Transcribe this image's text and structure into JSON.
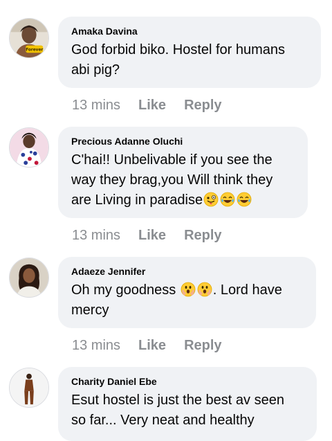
{
  "comments": [
    {
      "author": "Amaka Davina",
      "text_lines": [
        "God forbid biko. Hostel for humans",
        "abi pig?"
      ],
      "time": "13 mins",
      "like_label": "Like",
      "reply_label": "Reply"
    },
    {
      "author": "Precious Adanne Oluchi",
      "text_lines": [
        "C'hai!! Unbelivable if you see the",
        "way they  brag,you Will  think they",
        "are Living in paradise"
      ],
      "emojis": [
        "zany-face-emoji",
        "tears-of-joy-emoji",
        "tears-of-joy-emoji"
      ],
      "time": "13 mins",
      "like_label": "Like",
      "reply_label": "Reply"
    },
    {
      "author": "Adaeze Jennifer",
      "text_parts": [
        "Oh my goodness ",
        ". Lord have"
      ],
      "text_line2": "mercy",
      "emojis": [
        "shocked-face-emoji",
        "shocked-face-emoji"
      ],
      "time": "13 mins",
      "like_label": "Like",
      "reply_label": "Reply"
    },
    {
      "author": "Charity Daniel Ebe",
      "text_lines": [
        "Esut hostel is just the best av seen",
        "so far... Very neat and healthy"
      ]
    }
  ],
  "colors": {
    "bubble": "#f0f2f5",
    "text": "#050505",
    "meta": "#8a8d91"
  }
}
